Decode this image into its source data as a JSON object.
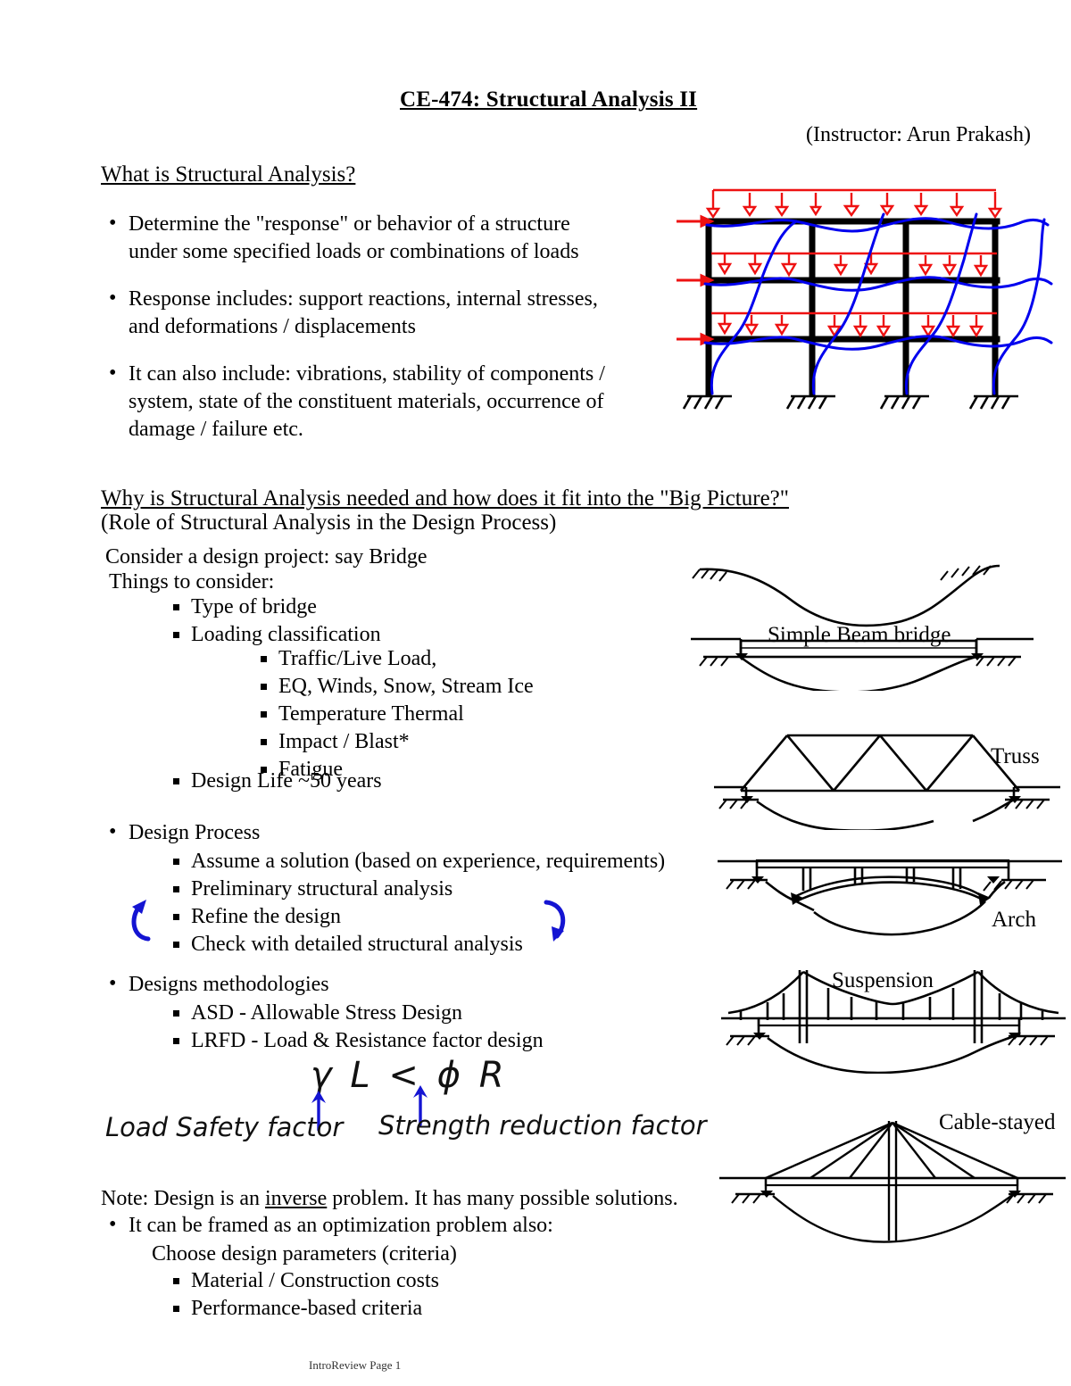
{
  "document": {
    "title": "CE-474: Structural Analysis II",
    "instructor": "(Instructor: Arun Prakash)",
    "footer": "IntroReview Page 1"
  },
  "section1": {
    "heading": "What is Structural Analysis?",
    "bullets": [
      "Determine the \"response\" or behavior of a structure under some specified loads or combinations of loads",
      "Response includes: support reactions, internal stresses, and deformations / displacements",
      "It can also include: vibrations, stability of components / system, state of the constituent materials, occurrence of damage / failure etc."
    ],
    "bullet_lines": [
      [
        "Determine the \"response\" or behavior of a structure",
        "under some specified loads or combinations of loads"
      ],
      [
        "Response includes: support reactions, internal stresses,",
        "and deformations / displacements"
      ],
      [
        "It can also include: vibrations, stability of components /",
        "system, state of the constituent materials, occurrence of",
        "damage / failure etc."
      ]
    ]
  },
  "section2": {
    "heading": "Why is Structural Analysis needed and how does it fit into the \"Big Picture?\"",
    "subheading": "(Role of Structural Analysis in the Design Process)",
    "intro1": "Consider a design project: say Bridge",
    "intro2": "Things to consider:",
    "considerations": [
      "Type of bridge",
      "Loading classification"
    ],
    "loading_sub": [
      "Traffic/Live Load,",
      "EQ, Winds, Snow, Stream Ice",
      "Temperature Thermal",
      "Impact / Blast*",
      "Fatigue"
    ],
    "design_life": "Design Life ~50 years",
    "design_process": {
      "label": "Design Process",
      "steps": [
        "Assume a solution (based on experience, requirements)",
        "Preliminary structural analysis",
        "Refine the design",
        "Check with detailed structural analysis"
      ]
    },
    "methodologies": {
      "label": "Designs methodologies",
      "items": [
        "ASD - Allowable Stress Design",
        "LRFD - Load & Resistance factor design"
      ]
    }
  },
  "handwriting": {
    "formula": "γ L < ϕ R",
    "annotation_left": "Load Safety factor",
    "annotation_right": "Strength reduction factor",
    "ink_color": "#1414d2"
  },
  "section3": {
    "note_pre": "Note: Design is an ",
    "note_underlined": "inverse",
    "note_post": " problem. It has many possible solutions.",
    "bullet": "It can be framed as an optimization problem also:",
    "sub": "Choose design parameters (criteria)",
    "criteria": [
      "Material / Construction costs",
      "Performance-based criteria"
    ]
  },
  "figures": {
    "frame": {
      "name": "multistory-frame-under-loads",
      "load_color": "#ee1111",
      "deflection_color": "#0000ee",
      "stories": 3,
      "bays": 3
    },
    "bridges": [
      {
        "label": "Simple Beam bridge",
        "type": "simple-beam"
      },
      {
        "label": "Truss",
        "type": "truss"
      },
      {
        "label": "Arch",
        "type": "arch"
      },
      {
        "label": "Suspension",
        "type": "suspension"
      },
      {
        "label": "Cable-stayed",
        "type": "cable-stayed"
      }
    ]
  }
}
